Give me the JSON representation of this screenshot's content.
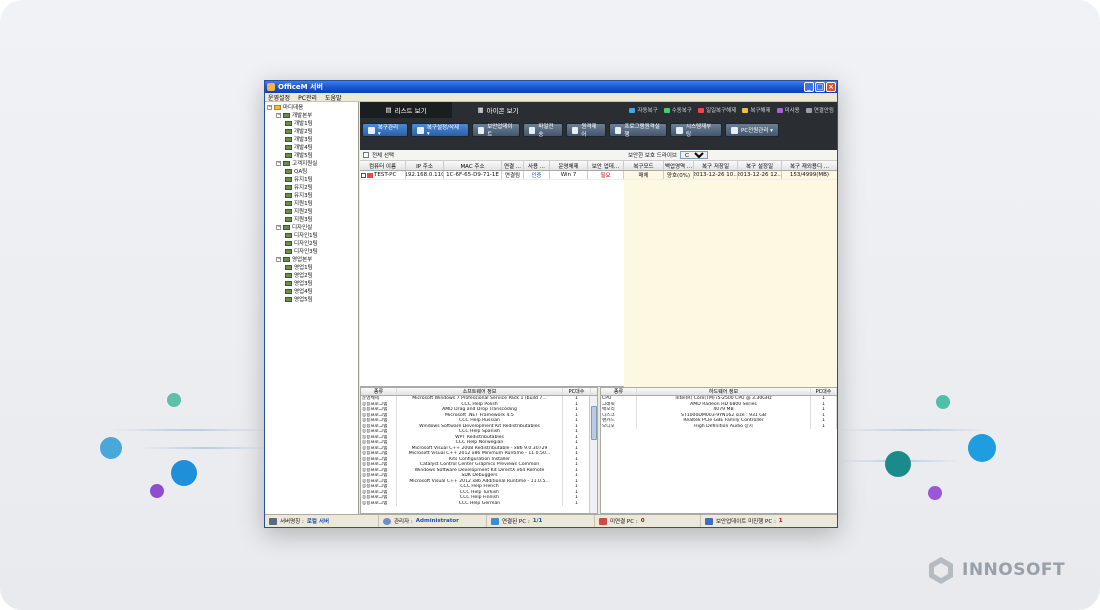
{
  "brand": {
    "name": "INNOSOFT"
  },
  "window": {
    "title": "OfficeM 서버",
    "controls": [
      "_",
      "□",
      "×"
    ]
  },
  "menu": [
    "운영설정",
    "PC관리",
    "도움말"
  ],
  "tree": [
    {
      "label": "마디데음",
      "level": 0
    },
    {
      "label": "개발본부",
      "level": 1
    },
    {
      "label": "개발1팀",
      "level": 2
    },
    {
      "label": "개발2팀",
      "level": 2
    },
    {
      "label": "개발3팀",
      "level": 2
    },
    {
      "label": "개발4팀",
      "level": 2
    },
    {
      "label": "개발5팀",
      "level": 2
    },
    {
      "label": "고객지원실",
      "level": 1
    },
    {
      "label": "QA팀",
      "level": 2
    },
    {
      "label": "유지1팀",
      "level": 2
    },
    {
      "label": "유지2팀",
      "level": 2
    },
    {
      "label": "유지3팀",
      "level": 2
    },
    {
      "label": "지원1팀",
      "level": 2
    },
    {
      "label": "지원2팀",
      "level": 2
    },
    {
      "label": "지원3팀",
      "level": 2
    },
    {
      "label": "디자인실",
      "level": 1
    },
    {
      "label": "디자인1팀",
      "level": 2
    },
    {
      "label": "디자인2팀",
      "level": 2
    },
    {
      "label": "디자인3팀",
      "level": 2
    },
    {
      "label": "영업본부",
      "level": 1
    },
    {
      "label": "영업1팀",
      "level": 2
    },
    {
      "label": "영업2팀",
      "level": 2
    },
    {
      "label": "영업3팀",
      "level": 2
    },
    {
      "label": "영업4팀",
      "level": 2
    },
    {
      "label": "영업5팀",
      "level": 2
    }
  ],
  "tabs": [
    {
      "label": "리스트 보기",
      "active": true
    },
    {
      "label": "아이콘 보기",
      "active": false
    }
  ],
  "legend": [
    {
      "label": "자동복구",
      "color": "#3fa7e8"
    },
    {
      "label": "수동복구",
      "color": "#3fd06a"
    },
    {
      "label": "일일복구해제",
      "color": "#e84a4a"
    },
    {
      "label": "복구해제",
      "color": "#f0c03a"
    },
    {
      "label": "미사용",
      "color": "#b05ce0"
    },
    {
      "label": "연결안됨",
      "color": "#9aa0a8"
    }
  ],
  "toolbar": [
    {
      "label": "복구관리 ▾",
      "blue": true
    },
    {
      "label": "복구설정/삭제 ▾",
      "blue": true
    },
    {
      "label": "보안업데이트",
      "blue": false
    },
    {
      "label": "파일전송",
      "blue": false
    },
    {
      "label": "원격제어",
      "blue": false
    },
    {
      "label": "프로그램원격실행",
      "blue": false
    },
    {
      "label": "시스템재부팅",
      "blue": false
    },
    {
      "label": "PC전원관리 ▾",
      "blue": false
    }
  ],
  "filter": {
    "select_all": "전체 선택",
    "drive_label": "보안한 보호 드라이브",
    "drive_value": "C"
  },
  "grid": {
    "columns": [
      "컴퓨터 이름",
      "IP 주소",
      "MAC 주소",
      "연결 ...",
      "사용 ...",
      "운영체제",
      "보안 업데...",
      "복구모드",
      "백업영역 ...",
      "복구 저장일",
      "복구 설정일",
      "복구 재외용디 ..."
    ],
    "rows": [
      [
        "TEST-PC",
        "192.168.0.110",
        "1C-6F-65-D9-71-1E",
        "연결됨",
        "인증",
        "Win 7",
        "필요",
        "매체",
        "양호(0%)",
        "2013-12-26 10...",
        "2013-12-26 12...",
        "153/4999(MB)"
      ]
    ]
  },
  "software": {
    "columns": [
      "종류",
      "소프트웨어 정보",
      "PC대수"
    ],
    "rows": [
      [
        "운영체제",
        "Microsoft Windows 7 Professional Service Pack 1 (build 7...",
        "1"
      ],
      [
        "응용프로그램",
        "CCC Help Polish",
        "1"
      ],
      [
        "응용프로그램",
        "AMD Drag and Drop Transcoding",
        "1"
      ],
      [
        "응용프로그램",
        "Microsoft .NET Framework 4.5",
        "1"
      ],
      [
        "응용프로그램",
        "CCC Help Russian",
        "1"
      ],
      [
        "응용프로그램",
        "Windows Software Development Kit Redistributables",
        "1"
      ],
      [
        "응용프로그램",
        "CCC Help Spanish",
        "1"
      ],
      [
        "응용프로그램",
        "WPT Redistributables",
        "1"
      ],
      [
        "응용프로그램",
        "CCC Help Norwegian",
        "1"
      ],
      [
        "응용프로그램",
        "Microsoft Visual C++ 2008 Redistributable - x86 9.0.30729",
        "1"
      ],
      [
        "응용프로그램",
        "Microsoft Visual C++ 2012 x86 Minimum Runtime - 11.0.50...",
        "1"
      ],
      [
        "응용프로그램",
        "Kits Configuration Installer",
        "1"
      ],
      [
        "응용프로그램",
        "Catalyst Control Center Graphics Previews Common",
        "1"
      ],
      [
        "응용프로그램",
        "Windows Software Development Kit DirectX x64 Remote",
        "1"
      ],
      [
        "응용프로그램",
        "SDK Debuggers",
        "1"
      ],
      [
        "응용프로그램",
        "Microsoft Visual C++ 2012 x86 Additional Runtime - 11.0.5...",
        "1"
      ],
      [
        "응용프로그램",
        "CCC Help French",
        "1"
      ],
      [
        "응용프로그램",
        "CCC Help Turkish",
        "1"
      ],
      [
        "응용프로그램",
        "CCC Help Finnish",
        "1"
      ],
      [
        "응용프로그램",
        "CCC Help German",
        "1"
      ]
    ]
  },
  "hardware": {
    "columns": [
      "종류",
      "하드웨어 정보",
      "PC대수"
    ],
    "rows": [
      [
        "CPU",
        "Intel(R) Core(TM) i5-2500 CPU @ 3.30GHz",
        "1"
      ],
      [
        "그래픽",
        "AMD Radeon HD 6800 Series",
        "1"
      ],
      [
        "메모리",
        "4079 MB",
        "1"
      ],
      [
        "디스크",
        "ST1000DM003-9YN162 size : 931 GB",
        "1"
      ],
      [
        "랜카드",
        "Realtek PCIe GBE Family Controller",
        "1"
      ],
      [
        "오디오",
        "High Definition Audio 장치",
        "1"
      ]
    ]
  },
  "status": {
    "server_label": "서버명칭 :",
    "server_value": "로컬 서버",
    "admin_label": "관리자 :",
    "admin_value": "Administrator",
    "connected_label": "연결된 PC :",
    "connected_value": "1/1",
    "failed_label": "미연결 PC :",
    "failed_value": "0",
    "update_label": "보안업데이트 미진행 PC :",
    "update_value": "1"
  }
}
